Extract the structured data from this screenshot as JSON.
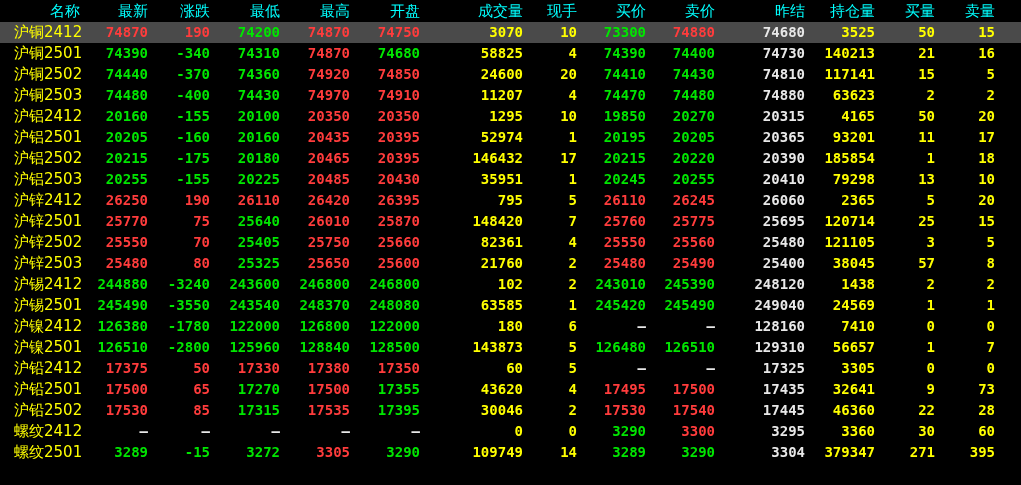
{
  "columns": [
    "名称",
    "最新",
    "涨跌",
    "最低",
    "最高",
    "开盘",
    "成交量",
    "现手",
    "买价",
    "卖价",
    "昨结",
    "持仓量",
    "买量",
    "卖量"
  ],
  "rows": [
    {
      "selected": true,
      "cells": [
        {
          "text": "沪铜2412",
          "color": "#ffff00"
        },
        {
          "text": "74870",
          "color": "#ff3c3c"
        },
        {
          "text": "190",
          "color": "#ff3c3c"
        },
        {
          "text": "74200",
          "color": "#00e600"
        },
        {
          "text": "74870",
          "color": "#ff3c3c"
        },
        {
          "text": "74750",
          "color": "#ff3c3c"
        },
        {
          "text": "3070",
          "color": "#ffff00"
        },
        {
          "text": "10",
          "color": "#ffff00"
        },
        {
          "text": "73300",
          "color": "#00e600"
        },
        {
          "text": "74880",
          "color": "#ff3c3c"
        },
        {
          "text": "74680",
          "color": "#e8e8e8"
        },
        {
          "text": "3525",
          "color": "#ffff00"
        },
        {
          "text": "50",
          "color": "#ffff00"
        },
        {
          "text": "15",
          "color": "#ffff00"
        }
      ]
    },
    {
      "selected": false,
      "cells": [
        {
          "text": "沪铜2501",
          "color": "#ffff00"
        },
        {
          "text": "74390",
          "color": "#00e600"
        },
        {
          "text": "-340",
          "color": "#00e600"
        },
        {
          "text": "74310",
          "color": "#00e600"
        },
        {
          "text": "74870",
          "color": "#ff3c3c"
        },
        {
          "text": "74680",
          "color": "#00e600"
        },
        {
          "text": "58825",
          "color": "#ffff00"
        },
        {
          "text": "4",
          "color": "#ffff00"
        },
        {
          "text": "74390",
          "color": "#00e600"
        },
        {
          "text": "74400",
          "color": "#00e600"
        },
        {
          "text": "74730",
          "color": "#e8e8e8"
        },
        {
          "text": "140213",
          "color": "#ffff00"
        },
        {
          "text": "21",
          "color": "#ffff00"
        },
        {
          "text": "16",
          "color": "#ffff00"
        }
      ]
    },
    {
      "selected": false,
      "cells": [
        {
          "text": "沪铜2502",
          "color": "#ffff00"
        },
        {
          "text": "74440",
          "color": "#00e600"
        },
        {
          "text": "-370",
          "color": "#00e600"
        },
        {
          "text": "74360",
          "color": "#00e600"
        },
        {
          "text": "74920",
          "color": "#ff3c3c"
        },
        {
          "text": "74850",
          "color": "#ff3c3c"
        },
        {
          "text": "24600",
          "color": "#ffff00"
        },
        {
          "text": "20",
          "color": "#ffff00"
        },
        {
          "text": "74410",
          "color": "#00e600"
        },
        {
          "text": "74430",
          "color": "#00e600"
        },
        {
          "text": "74810",
          "color": "#e8e8e8"
        },
        {
          "text": "117141",
          "color": "#ffff00"
        },
        {
          "text": "15",
          "color": "#ffff00"
        },
        {
          "text": "5",
          "color": "#ffff00"
        }
      ]
    },
    {
      "selected": false,
      "cells": [
        {
          "text": "沪铜2503",
          "color": "#ffff00"
        },
        {
          "text": "74480",
          "color": "#00e600"
        },
        {
          "text": "-400",
          "color": "#00e600"
        },
        {
          "text": "74430",
          "color": "#00e600"
        },
        {
          "text": "74970",
          "color": "#ff3c3c"
        },
        {
          "text": "74910",
          "color": "#ff3c3c"
        },
        {
          "text": "11207",
          "color": "#ffff00"
        },
        {
          "text": "4",
          "color": "#ffff00"
        },
        {
          "text": "74470",
          "color": "#00e600"
        },
        {
          "text": "74480",
          "color": "#00e600"
        },
        {
          "text": "74880",
          "color": "#e8e8e8"
        },
        {
          "text": "63623",
          "color": "#ffff00"
        },
        {
          "text": "2",
          "color": "#ffff00"
        },
        {
          "text": "2",
          "color": "#ffff00"
        }
      ]
    },
    {
      "selected": false,
      "cells": [
        {
          "text": "沪铝2412",
          "color": "#ffff00"
        },
        {
          "text": "20160",
          "color": "#00e600"
        },
        {
          "text": "-155",
          "color": "#00e600"
        },
        {
          "text": "20100",
          "color": "#00e600"
        },
        {
          "text": "20350",
          "color": "#ff3c3c"
        },
        {
          "text": "20350",
          "color": "#ff3c3c"
        },
        {
          "text": "1295",
          "color": "#ffff00"
        },
        {
          "text": "10",
          "color": "#ffff00"
        },
        {
          "text": "19850",
          "color": "#00e600"
        },
        {
          "text": "20270",
          "color": "#00e600"
        },
        {
          "text": "20315",
          "color": "#e8e8e8"
        },
        {
          "text": "4165",
          "color": "#ffff00"
        },
        {
          "text": "50",
          "color": "#ffff00"
        },
        {
          "text": "20",
          "color": "#ffff00"
        }
      ]
    },
    {
      "selected": false,
      "cells": [
        {
          "text": "沪铝2501",
          "color": "#ffff00"
        },
        {
          "text": "20205",
          "color": "#00e600"
        },
        {
          "text": "-160",
          "color": "#00e600"
        },
        {
          "text": "20160",
          "color": "#00e600"
        },
        {
          "text": "20435",
          "color": "#ff3c3c"
        },
        {
          "text": "20395",
          "color": "#ff3c3c"
        },
        {
          "text": "52974",
          "color": "#ffff00"
        },
        {
          "text": "1",
          "color": "#ffff00"
        },
        {
          "text": "20195",
          "color": "#00e600"
        },
        {
          "text": "20205",
          "color": "#00e600"
        },
        {
          "text": "20365",
          "color": "#e8e8e8"
        },
        {
          "text": "93201",
          "color": "#ffff00"
        },
        {
          "text": "11",
          "color": "#ffff00"
        },
        {
          "text": "17",
          "color": "#ffff00"
        }
      ]
    },
    {
      "selected": false,
      "cells": [
        {
          "text": "沪铝2502",
          "color": "#ffff00"
        },
        {
          "text": "20215",
          "color": "#00e600"
        },
        {
          "text": "-175",
          "color": "#00e600"
        },
        {
          "text": "20180",
          "color": "#00e600"
        },
        {
          "text": "20465",
          "color": "#ff3c3c"
        },
        {
          "text": "20395",
          "color": "#ff3c3c"
        },
        {
          "text": "146432",
          "color": "#ffff00"
        },
        {
          "text": "17",
          "color": "#ffff00"
        },
        {
          "text": "20215",
          "color": "#00e600"
        },
        {
          "text": "20220",
          "color": "#00e600"
        },
        {
          "text": "20390",
          "color": "#e8e8e8"
        },
        {
          "text": "185854",
          "color": "#ffff00"
        },
        {
          "text": "1",
          "color": "#ffff00"
        },
        {
          "text": "18",
          "color": "#ffff00"
        }
      ]
    },
    {
      "selected": false,
      "cells": [
        {
          "text": "沪铝2503",
          "color": "#ffff00"
        },
        {
          "text": "20255",
          "color": "#00e600"
        },
        {
          "text": "-155",
          "color": "#00e600"
        },
        {
          "text": "20225",
          "color": "#00e600"
        },
        {
          "text": "20485",
          "color": "#ff3c3c"
        },
        {
          "text": "20430",
          "color": "#ff3c3c"
        },
        {
          "text": "35951",
          "color": "#ffff00"
        },
        {
          "text": "1",
          "color": "#ffff00"
        },
        {
          "text": "20245",
          "color": "#00e600"
        },
        {
          "text": "20255",
          "color": "#00e600"
        },
        {
          "text": "20410",
          "color": "#e8e8e8"
        },
        {
          "text": "79298",
          "color": "#ffff00"
        },
        {
          "text": "13",
          "color": "#ffff00"
        },
        {
          "text": "10",
          "color": "#ffff00"
        }
      ]
    },
    {
      "selected": false,
      "cells": [
        {
          "text": "沪锌2412",
          "color": "#ffff00"
        },
        {
          "text": "26250",
          "color": "#ff3c3c"
        },
        {
          "text": "190",
          "color": "#ff3c3c"
        },
        {
          "text": "26110",
          "color": "#ff3c3c"
        },
        {
          "text": "26420",
          "color": "#ff3c3c"
        },
        {
          "text": "26395",
          "color": "#ff3c3c"
        },
        {
          "text": "795",
          "color": "#ffff00"
        },
        {
          "text": "5",
          "color": "#ffff00"
        },
        {
          "text": "26110",
          "color": "#ff3c3c"
        },
        {
          "text": "26245",
          "color": "#ff3c3c"
        },
        {
          "text": "26060",
          "color": "#e8e8e8"
        },
        {
          "text": "2365",
          "color": "#ffff00"
        },
        {
          "text": "5",
          "color": "#ffff00"
        },
        {
          "text": "20",
          "color": "#ffff00"
        }
      ]
    },
    {
      "selected": false,
      "cells": [
        {
          "text": "沪锌2501",
          "color": "#ffff00"
        },
        {
          "text": "25770",
          "color": "#ff3c3c"
        },
        {
          "text": "75",
          "color": "#ff3c3c"
        },
        {
          "text": "25640",
          "color": "#00e600"
        },
        {
          "text": "26010",
          "color": "#ff3c3c"
        },
        {
          "text": "25870",
          "color": "#ff3c3c"
        },
        {
          "text": "148420",
          "color": "#ffff00"
        },
        {
          "text": "7",
          "color": "#ffff00"
        },
        {
          "text": "25760",
          "color": "#ff3c3c"
        },
        {
          "text": "25775",
          "color": "#ff3c3c"
        },
        {
          "text": "25695",
          "color": "#e8e8e8"
        },
        {
          "text": "120714",
          "color": "#ffff00"
        },
        {
          "text": "25",
          "color": "#ffff00"
        },
        {
          "text": "15",
          "color": "#ffff00"
        }
      ]
    },
    {
      "selected": false,
      "cells": [
        {
          "text": "沪锌2502",
          "color": "#ffff00"
        },
        {
          "text": "25550",
          "color": "#ff3c3c"
        },
        {
          "text": "70",
          "color": "#ff3c3c"
        },
        {
          "text": "25405",
          "color": "#00e600"
        },
        {
          "text": "25750",
          "color": "#ff3c3c"
        },
        {
          "text": "25660",
          "color": "#ff3c3c"
        },
        {
          "text": "82361",
          "color": "#ffff00"
        },
        {
          "text": "4",
          "color": "#ffff00"
        },
        {
          "text": "25550",
          "color": "#ff3c3c"
        },
        {
          "text": "25560",
          "color": "#ff3c3c"
        },
        {
          "text": "25480",
          "color": "#e8e8e8"
        },
        {
          "text": "121105",
          "color": "#ffff00"
        },
        {
          "text": "3",
          "color": "#ffff00"
        },
        {
          "text": "5",
          "color": "#ffff00"
        }
      ]
    },
    {
      "selected": false,
      "cells": [
        {
          "text": "沪锌2503",
          "color": "#ffff00"
        },
        {
          "text": "25480",
          "color": "#ff3c3c"
        },
        {
          "text": "80",
          "color": "#ff3c3c"
        },
        {
          "text": "25325",
          "color": "#00e600"
        },
        {
          "text": "25650",
          "color": "#ff3c3c"
        },
        {
          "text": "25600",
          "color": "#ff3c3c"
        },
        {
          "text": "21760",
          "color": "#ffff00"
        },
        {
          "text": "2",
          "color": "#ffff00"
        },
        {
          "text": "25480",
          "color": "#ff3c3c"
        },
        {
          "text": "25490",
          "color": "#ff3c3c"
        },
        {
          "text": "25400",
          "color": "#e8e8e8"
        },
        {
          "text": "38045",
          "color": "#ffff00"
        },
        {
          "text": "57",
          "color": "#ffff00"
        },
        {
          "text": "8",
          "color": "#ffff00"
        }
      ]
    },
    {
      "selected": false,
      "cells": [
        {
          "text": "沪锡2412",
          "color": "#ffff00"
        },
        {
          "text": "244880",
          "color": "#00e600"
        },
        {
          "text": "-3240",
          "color": "#00e600"
        },
        {
          "text": "243600",
          "color": "#00e600"
        },
        {
          "text": "246800",
          "color": "#00e600"
        },
        {
          "text": "246800",
          "color": "#00e600"
        },
        {
          "text": "102",
          "color": "#ffff00"
        },
        {
          "text": "2",
          "color": "#ffff00"
        },
        {
          "text": "243010",
          "color": "#00e600"
        },
        {
          "text": "245390",
          "color": "#00e600"
        },
        {
          "text": "248120",
          "color": "#e8e8e8"
        },
        {
          "text": "1438",
          "color": "#ffff00"
        },
        {
          "text": "2",
          "color": "#ffff00"
        },
        {
          "text": "2",
          "color": "#ffff00"
        }
      ]
    },
    {
      "selected": false,
      "cells": [
        {
          "text": "沪锡2501",
          "color": "#ffff00"
        },
        {
          "text": "245490",
          "color": "#00e600"
        },
        {
          "text": "-3550",
          "color": "#00e600"
        },
        {
          "text": "243540",
          "color": "#00e600"
        },
        {
          "text": "248370",
          "color": "#00e600"
        },
        {
          "text": "248080",
          "color": "#00e600"
        },
        {
          "text": "63585",
          "color": "#ffff00"
        },
        {
          "text": "1",
          "color": "#ffff00"
        },
        {
          "text": "245420",
          "color": "#00e600"
        },
        {
          "text": "245490",
          "color": "#00e600"
        },
        {
          "text": "249040",
          "color": "#e8e8e8"
        },
        {
          "text": "24569",
          "color": "#ffff00"
        },
        {
          "text": "1",
          "color": "#ffff00"
        },
        {
          "text": "1",
          "color": "#ffff00"
        }
      ]
    },
    {
      "selected": false,
      "cells": [
        {
          "text": "沪镍2412",
          "color": "#ffff00"
        },
        {
          "text": "126380",
          "color": "#00e600"
        },
        {
          "text": "-1780",
          "color": "#00e600"
        },
        {
          "text": "122000",
          "color": "#00e600"
        },
        {
          "text": "126800",
          "color": "#00e600"
        },
        {
          "text": "122000",
          "color": "#00e600"
        },
        {
          "text": "180",
          "color": "#ffff00"
        },
        {
          "text": "6",
          "color": "#ffff00"
        },
        {
          "text": "—",
          "color": "#e8e8e8"
        },
        {
          "text": "—",
          "color": "#e8e8e8"
        },
        {
          "text": "128160",
          "color": "#e8e8e8"
        },
        {
          "text": "7410",
          "color": "#ffff00"
        },
        {
          "text": "0",
          "color": "#ffff00"
        },
        {
          "text": "0",
          "color": "#ffff00"
        }
      ]
    },
    {
      "selected": false,
      "cells": [
        {
          "text": "沪镍2501",
          "color": "#ffff00"
        },
        {
          "text": "126510",
          "color": "#00e600"
        },
        {
          "text": "-2800",
          "color": "#00e600"
        },
        {
          "text": "125960",
          "color": "#00e600"
        },
        {
          "text": "128840",
          "color": "#00e600"
        },
        {
          "text": "128500",
          "color": "#00e600"
        },
        {
          "text": "143873",
          "color": "#ffff00"
        },
        {
          "text": "5",
          "color": "#ffff00"
        },
        {
          "text": "126480",
          "color": "#00e600"
        },
        {
          "text": "126510",
          "color": "#00e600"
        },
        {
          "text": "129310",
          "color": "#e8e8e8"
        },
        {
          "text": "56657",
          "color": "#ffff00"
        },
        {
          "text": "1",
          "color": "#ffff00"
        },
        {
          "text": "7",
          "color": "#ffff00"
        }
      ]
    },
    {
      "selected": false,
      "cells": [
        {
          "text": "沪铅2412",
          "color": "#ffff00"
        },
        {
          "text": "17375",
          "color": "#ff3c3c"
        },
        {
          "text": "50",
          "color": "#ff3c3c"
        },
        {
          "text": "17330",
          "color": "#ff3c3c"
        },
        {
          "text": "17380",
          "color": "#ff3c3c"
        },
        {
          "text": "17350",
          "color": "#ff3c3c"
        },
        {
          "text": "60",
          "color": "#ffff00"
        },
        {
          "text": "5",
          "color": "#ffff00"
        },
        {
          "text": "—",
          "color": "#e8e8e8"
        },
        {
          "text": "—",
          "color": "#e8e8e8"
        },
        {
          "text": "17325",
          "color": "#e8e8e8"
        },
        {
          "text": "3305",
          "color": "#ffff00"
        },
        {
          "text": "0",
          "color": "#ffff00"
        },
        {
          "text": "0",
          "color": "#ffff00"
        }
      ]
    },
    {
      "selected": false,
      "cells": [
        {
          "text": "沪铅2501",
          "color": "#ffff00"
        },
        {
          "text": "17500",
          "color": "#ff3c3c"
        },
        {
          "text": "65",
          "color": "#ff3c3c"
        },
        {
          "text": "17270",
          "color": "#00e600"
        },
        {
          "text": "17500",
          "color": "#ff3c3c"
        },
        {
          "text": "17355",
          "color": "#00e600"
        },
        {
          "text": "43620",
          "color": "#ffff00"
        },
        {
          "text": "4",
          "color": "#ffff00"
        },
        {
          "text": "17495",
          "color": "#ff3c3c"
        },
        {
          "text": "17500",
          "color": "#ff3c3c"
        },
        {
          "text": "17435",
          "color": "#e8e8e8"
        },
        {
          "text": "32641",
          "color": "#ffff00"
        },
        {
          "text": "9",
          "color": "#ffff00"
        },
        {
          "text": "73",
          "color": "#ffff00"
        }
      ]
    },
    {
      "selected": false,
      "cells": [
        {
          "text": "沪铅2502",
          "color": "#ffff00"
        },
        {
          "text": "17530",
          "color": "#ff3c3c"
        },
        {
          "text": "85",
          "color": "#ff3c3c"
        },
        {
          "text": "17315",
          "color": "#00e600"
        },
        {
          "text": "17535",
          "color": "#ff3c3c"
        },
        {
          "text": "17395",
          "color": "#00e600"
        },
        {
          "text": "30046",
          "color": "#ffff00"
        },
        {
          "text": "2",
          "color": "#ffff00"
        },
        {
          "text": "17530",
          "color": "#ff3c3c"
        },
        {
          "text": "17540",
          "color": "#ff3c3c"
        },
        {
          "text": "17445",
          "color": "#e8e8e8"
        },
        {
          "text": "46360",
          "color": "#ffff00"
        },
        {
          "text": "22",
          "color": "#ffff00"
        },
        {
          "text": "28",
          "color": "#ffff00"
        }
      ]
    },
    {
      "selected": false,
      "cells": [
        {
          "text": "螺纹2412",
          "color": "#ffff00"
        },
        {
          "text": "—",
          "color": "#e8e8e8"
        },
        {
          "text": "—",
          "color": "#e8e8e8"
        },
        {
          "text": "—",
          "color": "#e8e8e8"
        },
        {
          "text": "—",
          "color": "#e8e8e8"
        },
        {
          "text": "—",
          "color": "#e8e8e8"
        },
        {
          "text": "0",
          "color": "#ffff00"
        },
        {
          "text": "0",
          "color": "#ffff00"
        },
        {
          "text": "3290",
          "color": "#00e600"
        },
        {
          "text": "3300",
          "color": "#ff3c3c"
        },
        {
          "text": "3295",
          "color": "#e8e8e8"
        },
        {
          "text": "3360",
          "color": "#ffff00"
        },
        {
          "text": "30",
          "color": "#ffff00"
        },
        {
          "text": "60",
          "color": "#ffff00"
        }
      ]
    },
    {
      "selected": false,
      "cells": [
        {
          "text": "螺纹2501",
          "color": "#ffff00"
        },
        {
          "text": "3289",
          "color": "#00e600"
        },
        {
          "text": "-15",
          "color": "#00e600"
        },
        {
          "text": "3272",
          "color": "#00e600"
        },
        {
          "text": "3305",
          "color": "#ff3c3c"
        },
        {
          "text": "3290",
          "color": "#00e600"
        },
        {
          "text": "109749",
          "color": "#ffff00"
        },
        {
          "text": "14",
          "color": "#ffff00"
        },
        {
          "text": "3289",
          "color": "#00e600"
        },
        {
          "text": "3290",
          "color": "#00e600"
        },
        {
          "text": "3304",
          "color": "#e8e8e8"
        },
        {
          "text": "379347",
          "color": "#ffff00"
        },
        {
          "text": "271",
          "color": "#ffff00"
        },
        {
          "text": "395",
          "color": "#ffff00"
        }
      ]
    }
  ]
}
